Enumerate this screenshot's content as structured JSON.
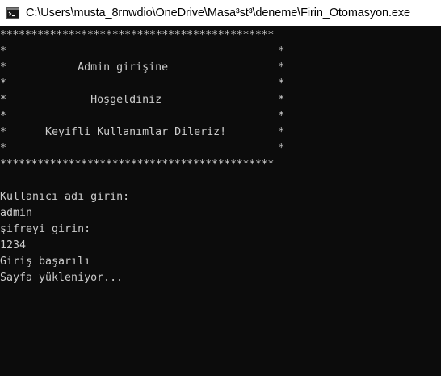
{
  "window": {
    "title": "C:\\Users\\musta_8rnwdio\\OneDrive\\Masa³st³\\deneme\\Firin_Otomasyon.exe",
    "icon": "console-app-icon",
    "background_color": "#0c0c0c",
    "text_color": "#cccccc"
  },
  "console": {
    "lines": [
      "********************************************",
      "*                                          *",
      "*           Admin girişine                 *",
      "*                                          *",
      "*             Hoşgeldiniz                  *",
      "*                                          *",
      "*      Keyifli Kullanımlar Dileriz!        *",
      "*                                          *",
      "********************************************",
      "",
      "Kullanıcı adı girin:",
      "admin",
      "şifreyi girin:",
      "1234",
      "Giriş başarılı",
      "Sayfa yükleniyor..."
    ]
  }
}
